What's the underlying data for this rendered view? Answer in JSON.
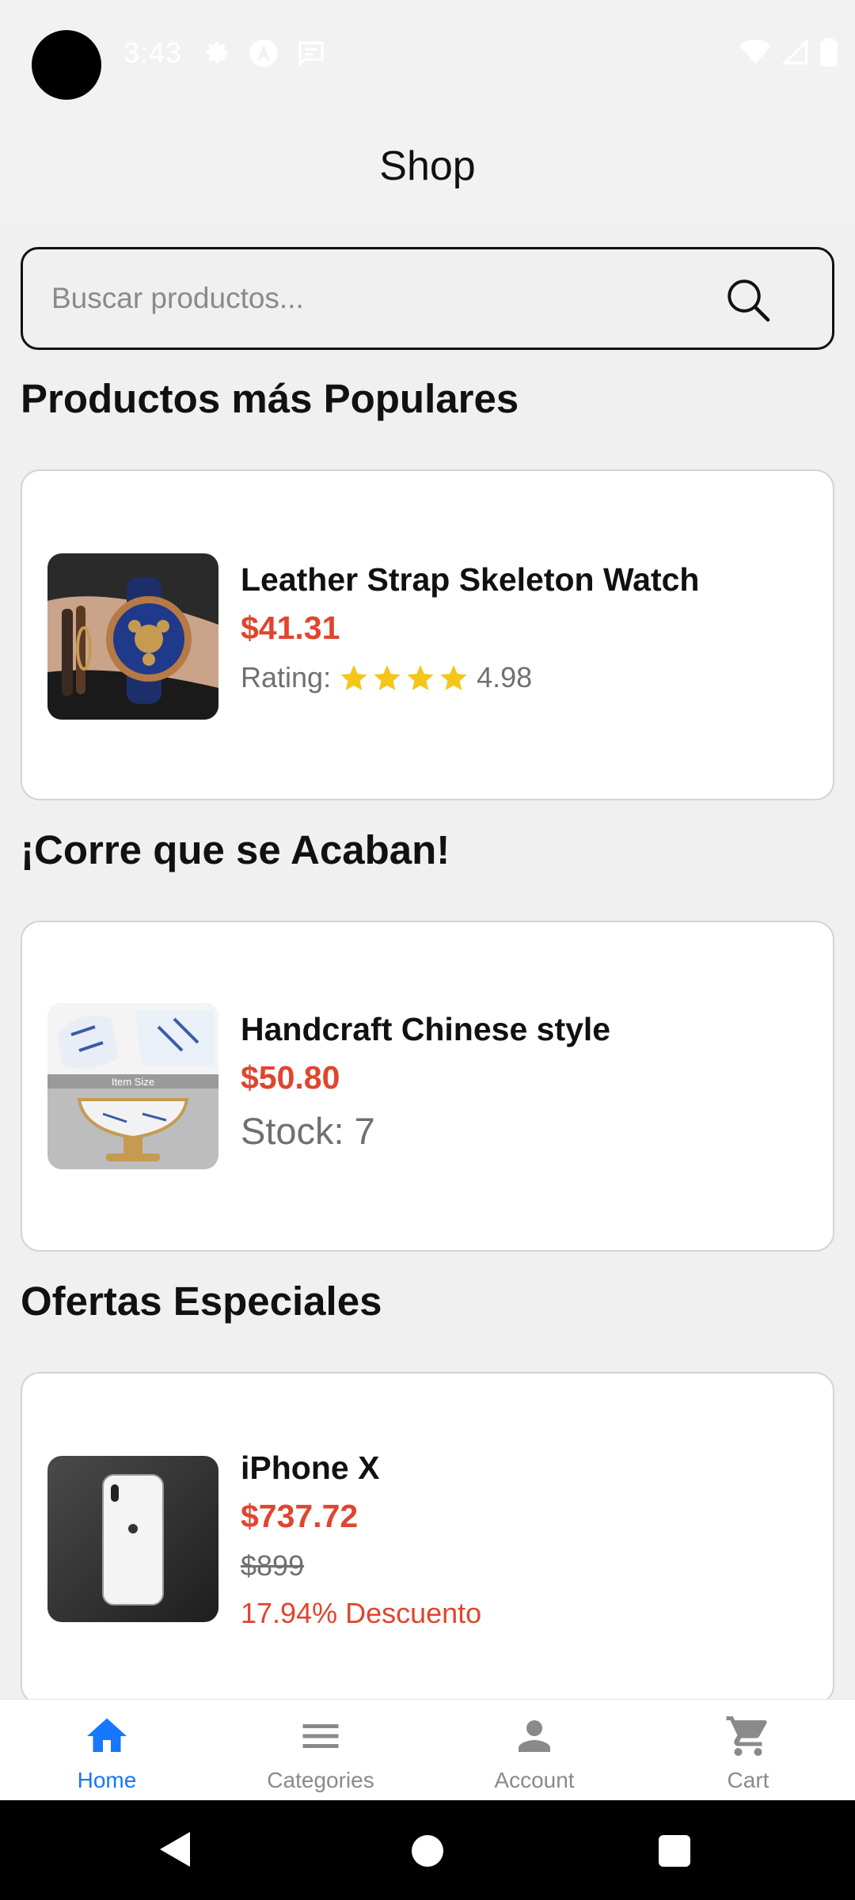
{
  "status_bar": {
    "time": "3:43",
    "icons_left": [
      "gear-icon",
      "a-logo-icon",
      "message-icon"
    ],
    "icons_right": [
      "wifi-icon",
      "signal-icon",
      "battery-icon"
    ]
  },
  "header": {
    "title": "Shop"
  },
  "search": {
    "placeholder": "Buscar productos...",
    "value": ""
  },
  "sections": {
    "popular": {
      "title": "Productos más Populares",
      "product": {
        "name": "Leather Strap Skeleton Watch",
        "price": "$41.31",
        "rating_label": "Rating:",
        "stars": 4,
        "rating_value": "4.98"
      }
    },
    "running_out": {
      "title": "¡Corre que se Acaban!",
      "product": {
        "name": "Handcraft Chinese style",
        "price": "$50.80",
        "stock": "Stock: 7",
        "image_caption": "Item Size"
      }
    },
    "offers": {
      "title": "Ofertas Especiales",
      "product": {
        "name": "iPhone X",
        "price": "$737.72",
        "old_price": "$899",
        "discount": "17.94% Descuento"
      }
    }
  },
  "bottom_nav": {
    "items": [
      {
        "label": "Home",
        "icon": "home-icon",
        "active": true
      },
      {
        "label": "Categories",
        "icon": "menu-icon",
        "active": false
      },
      {
        "label": "Account",
        "icon": "person-icon",
        "active": false
      },
      {
        "label": "Cart",
        "icon": "cart-icon",
        "active": false
      }
    ]
  },
  "colors": {
    "accent": "#1677ff",
    "price": "#e0452f",
    "star": "#f5c518",
    "background": "#f0f0f0"
  }
}
